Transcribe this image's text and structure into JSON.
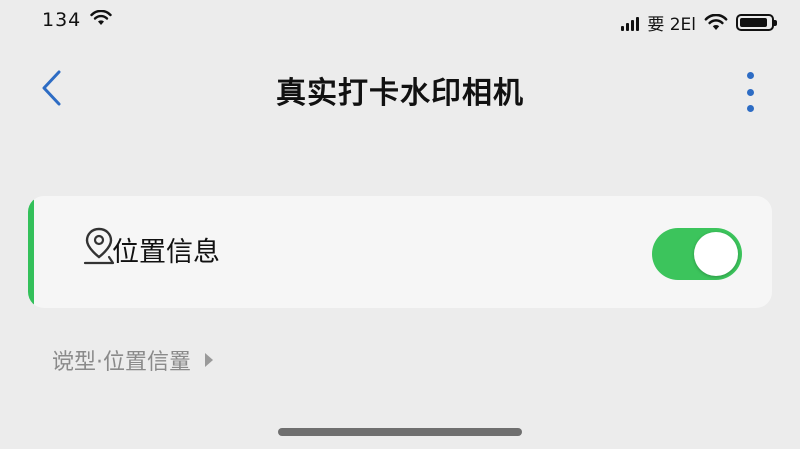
{
  "status_bar": {
    "time": "134",
    "carrier": "要 2El",
    "battery_level": 0.9
  },
  "nav": {
    "title": "真实打卡水印相机",
    "back_icon": "chevron-left-icon",
    "more_icon": "more-vertical-icon"
  },
  "setting": {
    "icon": "location-pin-icon",
    "label": "位置信息",
    "enabled": true,
    "accent_color": "#33c05a",
    "toggle_color": "#3cc45c"
  },
  "sub_link": {
    "label": "谠型·位置信罿",
    "icon": "chevron-right-icon"
  },
  "colors": {
    "accent_blue": "#2d6cc4",
    "background": "#ececec"
  }
}
